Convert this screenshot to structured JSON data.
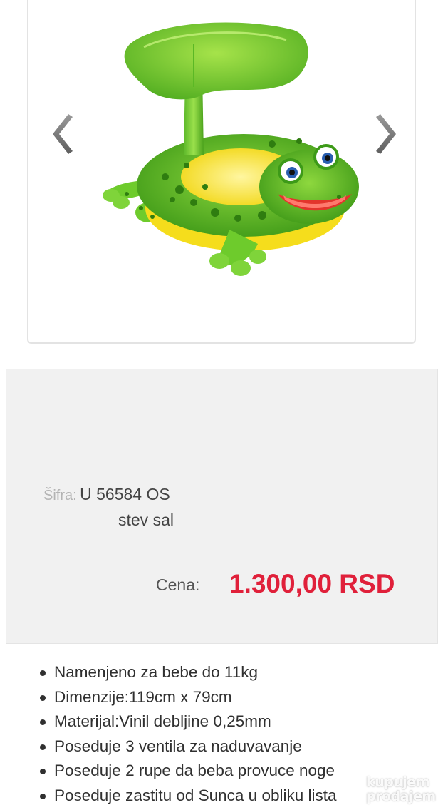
{
  "product": {
    "image_alt": "frog-baby-float-with-leaf-canopy"
  },
  "gallery": {
    "prev_icon": "chevron-left-icon",
    "next_icon": "chevron-right-icon"
  },
  "info": {
    "sku_label": "Šifra:",
    "sku_value": "U 56584 OS",
    "seller": "stev sal",
    "price_label": "Cena:",
    "price_value": "1.300,00 RSD"
  },
  "features": [
    "Namenjeno za bebe do 11kg",
    "Dimenzije:119cm x 79cm",
    "Materijal:Vinil debljine 0,25mm",
    "Poseduje 3 ventila za naduvavanje",
    "Poseduje 2 rupe da beba provuce noge",
    "Poseduje zastitu od Sunca u obliku lista"
  ],
  "watermark": {
    "line1": "kupujem",
    "line2": "prodajem"
  },
  "colors": {
    "price": "#e0203a",
    "panel_bg": "#f1f1f1"
  }
}
